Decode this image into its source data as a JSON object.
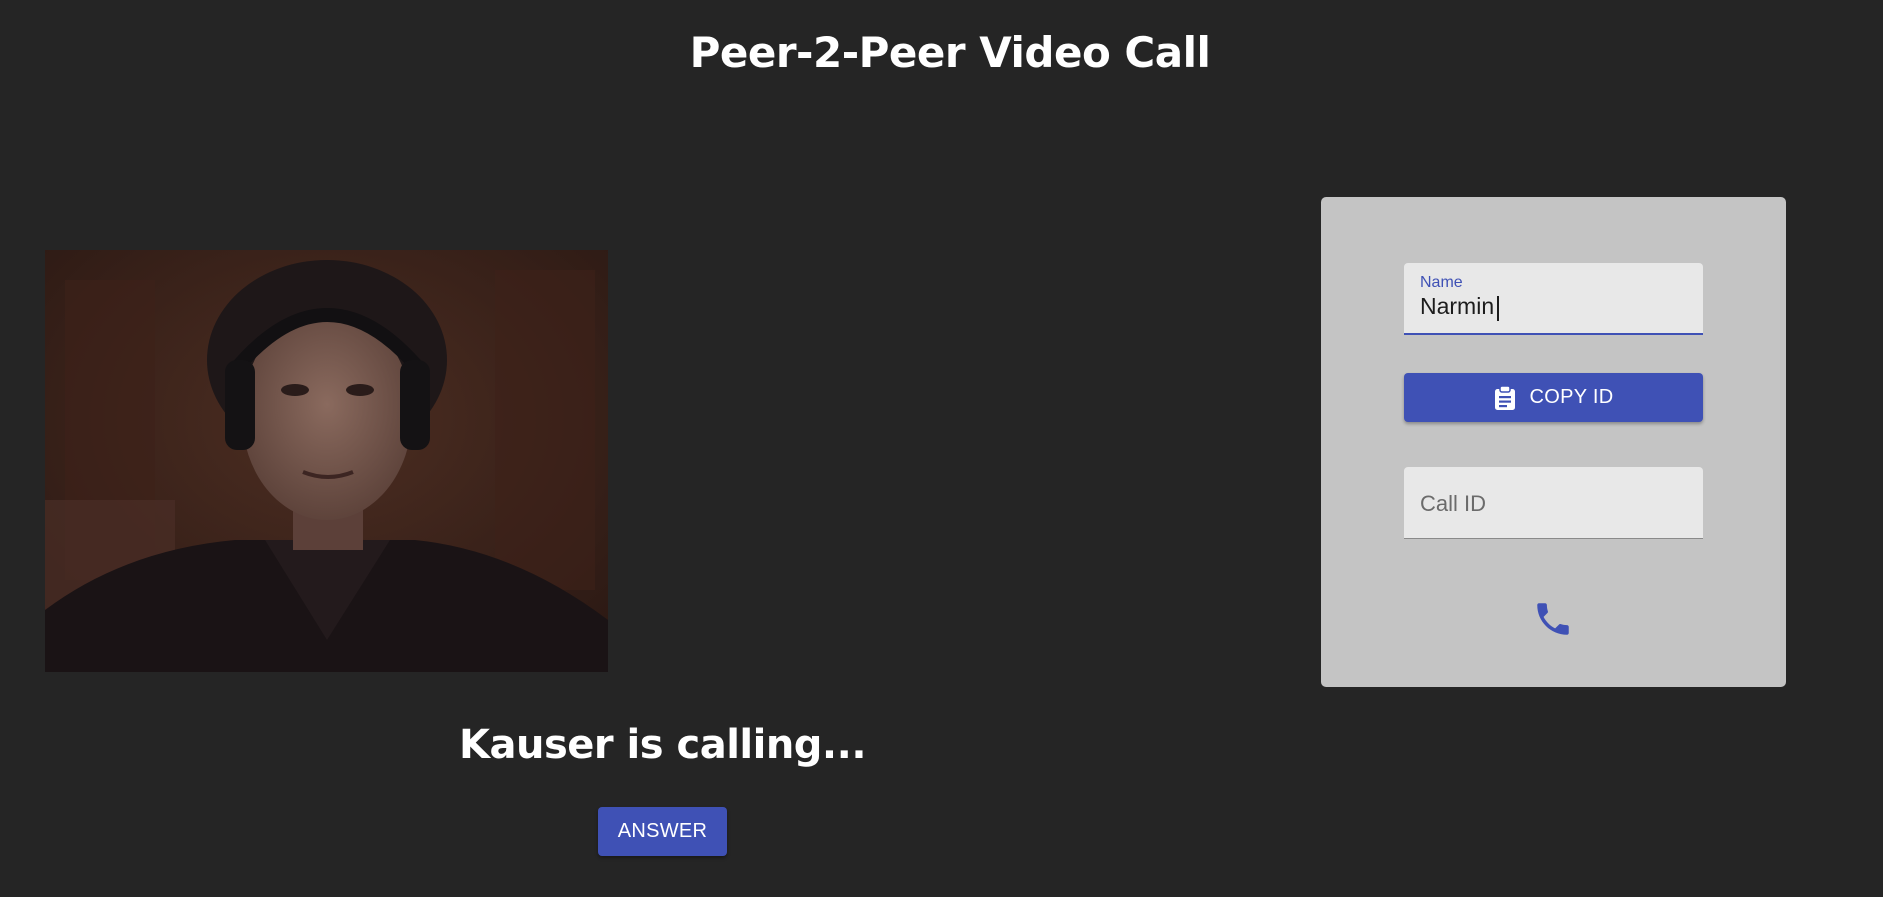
{
  "header": {
    "title": "Peer-2-Peer Video Call"
  },
  "video": {
    "description_icon": "webcam-video-feed"
  },
  "incoming_call": {
    "message": "Kauser is calling...",
    "answer_label": "ANSWER"
  },
  "panel": {
    "name_field": {
      "label": "Name",
      "value": "Narmin"
    },
    "copy_button": {
      "label": "COPY ID",
      "icon": "clipboard-icon"
    },
    "call_id_field": {
      "placeholder": "Call ID",
      "value": ""
    },
    "call_button": {
      "icon": "phone-icon"
    }
  },
  "colors": {
    "background": "#252525",
    "panel": "#c4c4c4",
    "field": "#e8e8e8",
    "accent": "#3f51b5",
    "text_light": "#ffffff"
  }
}
